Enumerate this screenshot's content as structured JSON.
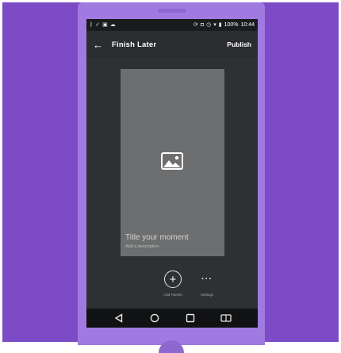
{
  "status_bar": {
    "left_icons": [
      "bluetooth-icon",
      "signal-check-icon",
      "image-icon",
      "cloud-icon"
    ],
    "right_icons": [
      "sync-icon",
      "nfc-icon",
      "alarm-icon",
      "wifi-icon",
      "battery-icon"
    ],
    "battery": "100%",
    "time": "10:44"
  },
  "toolbar": {
    "back_icon": "←",
    "title": "Finish Later",
    "publish_label": "Publish"
  },
  "moment": {
    "image_icon": "image-placeholder-icon",
    "title_placeholder": "Title your moment",
    "description_placeholder": "Add a description"
  },
  "actions": {
    "add_symbol": "+",
    "add_label": "Add Tweets",
    "more_symbol": "···",
    "more_label": "Settings"
  },
  "colors": {
    "background": "#7d4bc6",
    "phone": "#a07ae0",
    "screen": "#2e3033",
    "card": "#6d6e6f"
  }
}
